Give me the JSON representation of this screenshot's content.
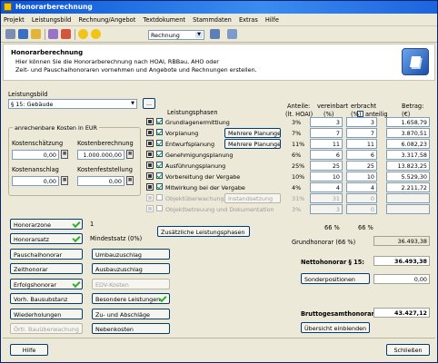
{
  "window": {
    "title": "Honorarberechnung"
  },
  "menu": [
    "Projekt",
    "Leistungsbild",
    "Rechnung/Angebot",
    "Textdokument",
    "Stammdaten",
    "Extras",
    "Hilfe"
  ],
  "toolbar": {
    "doc_type": "Rechnung",
    "icons": [
      "print-icon",
      "save-icon",
      "folder-icon",
      "edit-icon",
      "paint-icon",
      "help-icon",
      "info-icon",
      "list-icon",
      "window-icon"
    ]
  },
  "header": {
    "title": "Honorarberechnung",
    "line1": "Hier können Sie die Honorarberechnung nach HOAI, RBBau, AHO oder",
    "line2": "Zeit- und Pauschalhonoraren vornehmen und Angebote und Rechnungen erstellen."
  },
  "leistungsbild": {
    "label": "Leistungsbild",
    "value": "§ 15: Gebäude",
    "more": "..."
  },
  "costs": {
    "group": "anrechenbare Kosten in EUR",
    "schaetzung_label": "Kostenschätzung",
    "schaetzung": "0,00",
    "berechnung_label": "Kostenberechnung",
    "berechnung": "1.000.000,00",
    "anschlag_label": "Kostenanschlag",
    "anschlag": "0,00",
    "feststellung_label": "Kostenfeststellung",
    "feststellung": "0,00"
  },
  "phases": {
    "header": {
      "name": "Leistungsphasen",
      "anteile": "Anteile:",
      "anteile_sub": "(lt. HOAI)",
      "vereinbart": "vereinbart",
      "vereinbart_sub": "(%)",
      "erbracht": "erbracht",
      "anteilig": "anteilig",
      "erbracht_sub": "(%)",
      "betrag": "Betrag:",
      "betrag_sub": "(€)"
    },
    "rows": [
      {
        "name": "Grundlagenermittlung",
        "hoai": "3%",
        "vereinbart": "3",
        "erbracht": "3",
        "betrag": "1.658,79",
        "checked": true,
        "disabled": false,
        "extra": ""
      },
      {
        "name": "Vorplanung",
        "hoai": "7%",
        "vereinbart": "7",
        "erbracht": "7",
        "betrag": "3.870,51",
        "checked": true,
        "disabled": false,
        "extra": "Mehrere Planungen"
      },
      {
        "name": "Entwurfsplanung",
        "hoai": "11%",
        "vereinbart": "11",
        "erbracht": "11",
        "betrag": "6.082,23",
        "checked": true,
        "disabled": false,
        "extra": "Mehrere Planungen"
      },
      {
        "name": "Genehmigungsplanung",
        "hoai": "6%",
        "vereinbart": "6",
        "erbracht": "6",
        "betrag": "3.317,58",
        "checked": true,
        "disabled": false,
        "extra": ""
      },
      {
        "name": "Ausführungsplanung",
        "hoai": "25%",
        "vereinbart": "25",
        "erbracht": "25",
        "betrag": "13.823,25",
        "checked": true,
        "disabled": false,
        "extra": ""
      },
      {
        "name": "Vorbereitung der Vergabe",
        "hoai": "10%",
        "vereinbart": "10",
        "erbracht": "10",
        "betrag": "5.529,30",
        "checked": true,
        "disabled": false,
        "extra": ""
      },
      {
        "name": "Mitwirkung bei der Vergabe",
        "hoai": "4%",
        "vereinbart": "4",
        "erbracht": "4",
        "betrag": "2.211,72",
        "checked": true,
        "disabled": false,
        "extra": ""
      },
      {
        "name": "Objektüberwachung",
        "hoai": "31%",
        "vereinbart": "31",
        "erbracht": "0",
        "betrag": "",
        "checked": false,
        "disabled": true,
        "extra": "Instandsetzung"
      },
      {
        "name": "Objektbetreuung und Dokumentation",
        "hoai": "3%",
        "vereinbart": "3",
        "erbracht": "0",
        "betrag": "",
        "checked": false,
        "disabled": true,
        "extra": ""
      }
    ],
    "sum_vereinbart": "66 %",
    "sum_erbracht": "66 %",
    "extra_button": "Zusätzliche Leistungsphasen"
  },
  "totals": {
    "grundhonorar_label": "Grundhonorar (66 %)",
    "grundhonorar": "36.493,38",
    "netto_label": "Nettohonorar § 15:",
    "netto": "36.493,38",
    "sonderpositionen": "Sonderpositionen",
    "sonder_value": "0,00",
    "brutto_label": "Bruttogesamthonorar:",
    "brutto": "43.427,12",
    "overview": "Übersicht einblenden"
  },
  "left_buttons": {
    "honorarzone": "Honorarzone",
    "honorarzone_value": "1",
    "honorarsatz": "Honorarsatz",
    "honorarsatz_value": "Mindestsatz (0%)",
    "pauschal": "Pauschalhonorar",
    "umbau": "Umbauzuschlag",
    "zeit": "Zeithonorar",
    "ausbau": "Ausbauzuschlag",
    "erfolg": "Erfolgshonorar",
    "edv": "EDV-Kosten",
    "vorh": "Vorh. Bausubstanz",
    "besondere": "Besondere Leistungen",
    "wieder": "Wiederholungen",
    "zu_ab": "Zu- und Abschläge",
    "oertl": "Örtl. Bauüberwachung",
    "neben": "Nebenkosten"
  },
  "footer": {
    "help": "Hilfe",
    "close": "Schließen"
  },
  "colors": {
    "accent": "#0a55d8",
    "check": "#31b031"
  }
}
